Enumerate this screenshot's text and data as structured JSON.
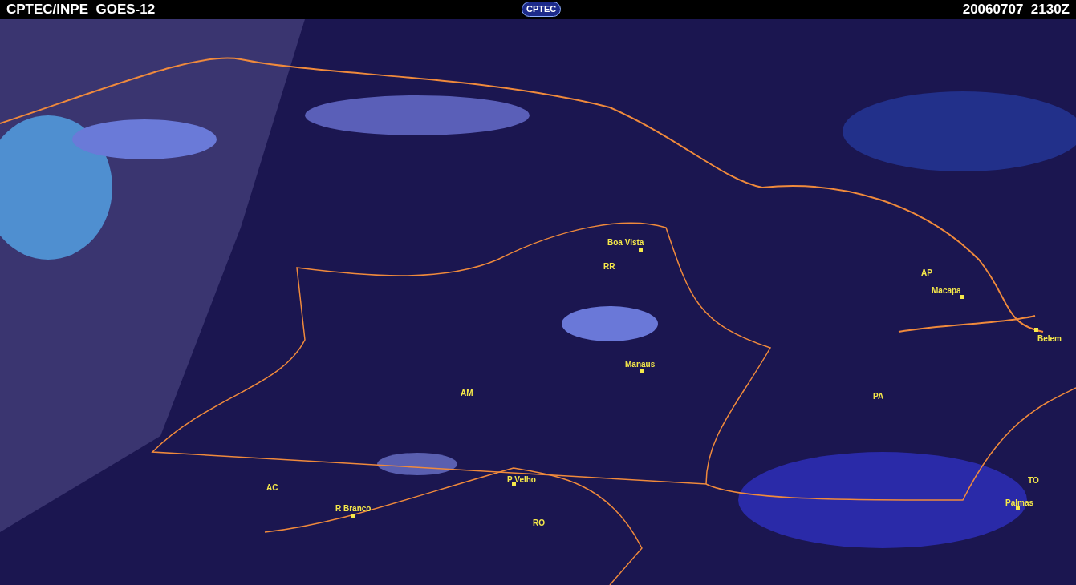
{
  "header": {
    "title": "CPTEC/INPE  GOES-12",
    "logo": "CPTEC",
    "timestamp": "20060707  2130Z"
  },
  "map": {
    "places": [
      {
        "kind": "city",
        "name": "Boa Vista"
      },
      {
        "kind": "state",
        "name": "RR"
      },
      {
        "kind": "state",
        "name": "AP"
      },
      {
        "kind": "city",
        "name": "Macapa"
      },
      {
        "kind": "city",
        "name": "Belem"
      },
      {
        "kind": "city",
        "name": "Manaus"
      },
      {
        "kind": "state",
        "name": "AM"
      },
      {
        "kind": "state",
        "name": "PA"
      },
      {
        "kind": "state",
        "name": "AC"
      },
      {
        "kind": "city",
        "name": "P Velho"
      },
      {
        "kind": "city",
        "name": "R Branco"
      },
      {
        "kind": "state",
        "name": "RO"
      },
      {
        "kind": "state",
        "name": "TO"
      },
      {
        "kind": "city",
        "name": "Palmas"
      }
    ]
  }
}
